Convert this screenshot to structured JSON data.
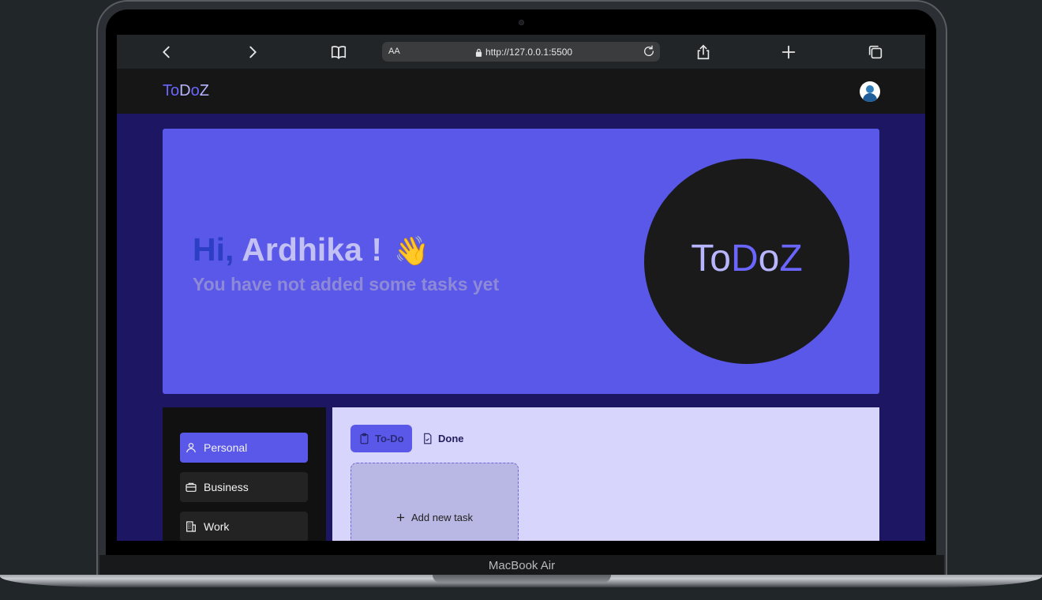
{
  "device": {
    "label": "MacBook Air"
  },
  "browser": {
    "reader_label": "AA",
    "url": "http://127.0.0.1:5500",
    "icons": [
      "chevron-left-icon",
      "chevron-right-icon",
      "book-icon",
      "lock-icon",
      "reload-icon",
      "share-icon",
      "plus-icon",
      "tabs-icon"
    ]
  },
  "app": {
    "logo": {
      "part1": "To",
      "part2": "D",
      "part3": "o",
      "part4": "Z"
    },
    "avatar_icon": "user-avatar-icon"
  },
  "hero": {
    "hi": "Hi,",
    "name": "Ardhika !",
    "wave": "👋",
    "subtitle": "You have not added some tasks yet",
    "circle_logo": {
      "part1": "To",
      "part2": "D",
      "part3": "o",
      "part4": "Z"
    }
  },
  "sidebar": {
    "items": [
      {
        "label": "Personal",
        "icon": "user-icon",
        "active": true
      },
      {
        "label": "Business",
        "icon": "briefcase-icon",
        "active": false
      },
      {
        "label": "Work",
        "icon": "building-icon",
        "active": false
      }
    ]
  },
  "tabs": [
    {
      "label": "To-Do",
      "icon": "clipboard-icon",
      "active": true
    },
    {
      "label": "Done",
      "icon": "file-check-icon",
      "active": false
    }
  ],
  "add_task": {
    "label": "Add new task",
    "icon": "plus-icon"
  },
  "colors": {
    "accent": "#5a58e8",
    "background": "#1c1663",
    "panel": "#d7d5fb",
    "navbar": "#161616"
  }
}
